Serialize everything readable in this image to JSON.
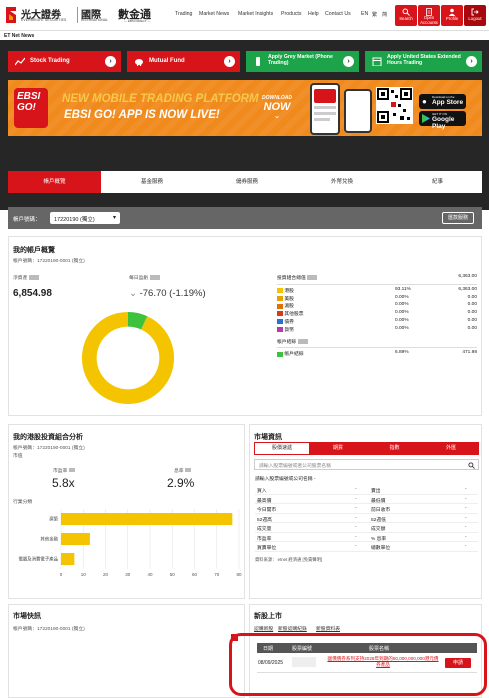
{
  "header": {
    "logo_cn": "光大證券",
    "logo_en": "EVERBRIGHT SECURITIES",
    "logo_intl_cn": "國際",
    "logo_intl_en": "INTERNATIONAL",
    "logo2": "數金通",
    "logo2_sub": "— EBSI DIRECT —",
    "nav": [
      "Trading",
      "Market News",
      "Market Insights",
      "Products",
      "Help",
      "Contact Us",
      "EN",
      "繁",
      "简"
    ],
    "buttons": [
      "Search",
      "Open Accounts",
      "Profile",
      "Logout"
    ]
  },
  "subbar": {
    "label": "ET Net News"
  },
  "quick_buttons": [
    {
      "label": "Stock Trading",
      "color": "#d7141a"
    },
    {
      "label": "Mutual Fund",
      "color": "#d7141a"
    },
    {
      "label": "Apply Grey Market (Phone Trading)",
      "color": "#1da34a"
    },
    {
      "label": "Apply United States Extended Hours Trading",
      "color": "#1da34a"
    }
  ],
  "banner": {
    "logo": "EBSI GO!",
    "line1": "NEW MOBILE TRADING PLATFORM",
    "line2": "EBSI GO! APP IS NOW LIVE!",
    "download1": "DOWNLOAD",
    "download2": "NOW",
    "app_store_top": "Download on the",
    "app_store": "App Store",
    "google_play_top": "GET IT ON",
    "google_play": "Google Play"
  },
  "tabs": [
    "帳戶概覽",
    "基金服務",
    "儲券服務",
    "外幣兌換",
    "紀事"
  ],
  "account_bar": {
    "label": "帳戶號碼：",
    "selected": "17220190 (獨立)",
    "button": "匯款服務"
  },
  "overview": {
    "title": "我的帳戶概覽",
    "account_line": "帳戶號碼：17220190-0001 (獨立)",
    "total_label": "淨資產",
    "total_value": "6,854.98",
    "daily_label": "每日盈虧",
    "daily_value": "-76.70 (-1.19%)",
    "assets_header": {
      "label": "投資組合總值",
      "value": "6,363.00"
    },
    "assets": [
      {
        "name": "港股",
        "pct": "93.11%",
        "value": "6,363.00",
        "color": "#f5c400"
      },
      {
        "name": "美股",
        "pct": "0.00%",
        "value": "0.00",
        "color": "#e8a000"
      },
      {
        "name": "滬股",
        "pct": "0.00%",
        "value": "0.00",
        "color": "#e07000"
      },
      {
        "name": "其他股票",
        "pct": "0.00%",
        "value": "0.00",
        "color": "#d73a1a"
      },
      {
        "name": "債券",
        "pct": "0.00%",
        "value": "0.00",
        "color": "#2c6fd1"
      },
      {
        "name": "貨幣",
        "pct": "0.00%",
        "value": "0.00",
        "color": "#b33ab0"
      }
    ],
    "cash_header": "帳戶結餘",
    "cash": {
      "name": "帳戶結餘",
      "pct": "6.89%",
      "value": "471.98",
      "color": "#3cc23c"
    },
    "donut": {
      "hk_pct": 93.11,
      "cash_pct": 6.89,
      "hk_color": "#f5c400",
      "cash_color": "#3cc23c"
    }
  },
  "hk_portfolio": {
    "title": "我的港股投資組合分析",
    "account_line": "帳戶號碼：17220190-0001 (獨立)",
    "sub_label": "市值",
    "pe_label": "市盈率",
    "pe_value": "5.8x",
    "yield_label": "息率",
    "yield_value": "2.9%",
    "sector_label": "行業分類",
    "chart_data": {
      "type": "bar",
      "categories": [
        "建築",
        "其他金融",
        "電腦及消費電子產品"
      ],
      "values": [
        77,
        13,
        6
      ],
      "xlim": [
        0,
        80
      ],
      "xticks": [
        "0",
        "10",
        "20",
        "30",
        "40",
        "50",
        "60",
        "70",
        "80"
      ]
    }
  },
  "market_info": {
    "title": "市場資訊",
    "tabs": [
      "股價速遞",
      "期貨",
      "指數",
      "外匯"
    ],
    "search_placeholder": "請輸入股票編號或者公司股票名稱",
    "stock_line": "請輸入股票編號或公司名稱 -",
    "rows": [
      [
        "買入",
        "-",
        "賣出",
        "-"
      ],
      [
        "最高價",
        "-",
        "最低價",
        "-"
      ],
      [
        "今日開市",
        "-",
        "前日收市",
        "-"
      ],
      [
        "52週高",
        "-",
        "52週低",
        "-"
      ],
      [
        "成交量",
        "-",
        "成交額",
        "-"
      ],
      [
        "市盈率",
        "-",
        "% 息率",
        "-"
      ],
      [
        "買賣單位",
        "-",
        "總數單位",
        "-"
      ]
    ],
    "footer": "資料來源： etnet 經濟通 [免責聲明]"
  },
  "market_news": {
    "title": "市場快訊",
    "account_line": "帳戶號碼：17220190-0001 (獨立)"
  },
  "ipo": {
    "title": "新股上市",
    "links": [
      "認購新股",
      "新股認購紀錄",
      "新股資料表"
    ],
    "headers": [
      "日期",
      "股票編號",
      "股票名稱",
      ""
    ],
    "row": {
      "date": "08/09/2025",
      "code": "",
      "name": "國債債券系列支持2028年到期的50,000,000,000港元債券產品",
      "action": "申請"
    }
  }
}
